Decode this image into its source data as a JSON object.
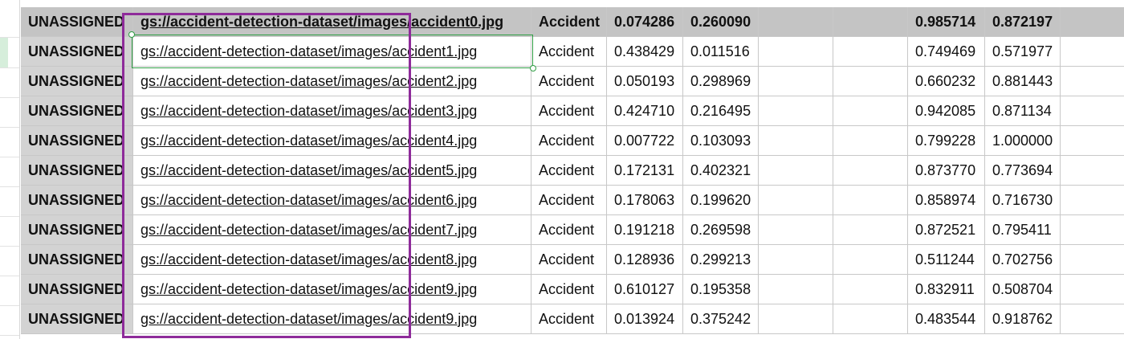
{
  "sheet": {
    "rows": [
      {
        "label": "UNASSIGNED",
        "uri": "gs://accident-detection-dataset/images/accident0.jpg",
        "class": "Accident",
        "v1": "0.074286",
        "v2": "0.260090",
        "v3": "0.985714",
        "v4": "0.872197"
      },
      {
        "label": "UNASSIGNED",
        "uri": "gs://accident-detection-dataset/images/accident1.jpg",
        "class": "Accident",
        "v1": "0.438429",
        "v2": "0.011516",
        "v3": "0.749469",
        "v4": "0.571977"
      },
      {
        "label": "UNASSIGNED",
        "uri": "gs://accident-detection-dataset/images/accident2.jpg",
        "class": "Accident",
        "v1": "0.050193",
        "v2": "0.298969",
        "v3": "0.660232",
        "v4": "0.881443"
      },
      {
        "label": "UNASSIGNED",
        "uri": "gs://accident-detection-dataset/images/accident3.jpg",
        "class": "Accident",
        "v1": "0.424710",
        "v2": "0.216495",
        "v3": "0.942085",
        "v4": "0.871134"
      },
      {
        "label": "UNASSIGNED",
        "uri": "gs://accident-detection-dataset/images/accident4.jpg",
        "class": "Accident",
        "v1": "0.007722",
        "v2": "0.103093",
        "v3": "0.799228",
        "v4": "1.000000"
      },
      {
        "label": "UNASSIGNED",
        "uri": "gs://accident-detection-dataset/images/accident5.jpg",
        "class": "Accident",
        "v1": "0.172131",
        "v2": "0.402321",
        "v3": "0.873770",
        "v4": "0.773694"
      },
      {
        "label": "UNASSIGNED",
        "uri": "gs://accident-detection-dataset/images/accident6.jpg",
        "class": "Accident",
        "v1": "0.178063",
        "v2": "0.199620",
        "v3": "0.858974",
        "v4": "0.716730"
      },
      {
        "label": "UNASSIGNED",
        "uri": "gs://accident-detection-dataset/images/accident7.jpg",
        "class": "Accident",
        "v1": "0.191218",
        "v2": "0.269598",
        "v3": "0.872521",
        "v4": "0.795411"
      },
      {
        "label": "UNASSIGNED",
        "uri": "gs://accident-detection-dataset/images/accident8.jpg",
        "class": "Accident",
        "v1": "0.128936",
        "v2": "0.299213",
        "v3": "0.511244",
        "v4": "0.702756"
      },
      {
        "label": "UNASSIGNED",
        "uri": "gs://accident-detection-dataset/images/accident9.jpg",
        "class": "Accident",
        "v1": "0.610127",
        "v2": "0.195358",
        "v3": "0.832911",
        "v4": "0.508704"
      },
      {
        "label": "UNASSIGNED",
        "uri": "gs://accident-detection-dataset/images/accident9.jpg",
        "class": "Accident",
        "v1": "0.013924",
        "v2": "0.375242",
        "v3": "0.483544",
        "v4": "0.918762"
      }
    ]
  },
  "colors": {
    "header_row_bg": "#c4c4c4",
    "label_cell_bg": "#d3d3d3",
    "selection_border": "#2f9e44",
    "highlight_border": "#8e2b9a"
  }
}
